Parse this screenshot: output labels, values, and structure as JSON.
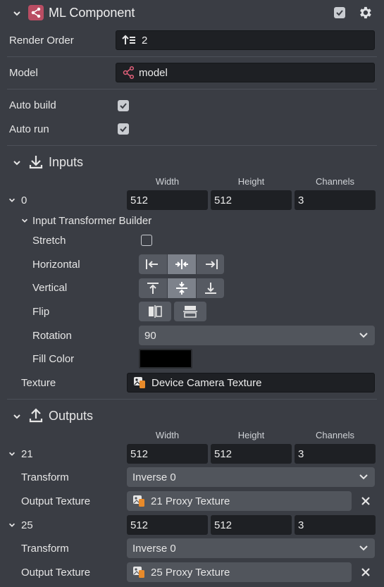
{
  "header": {
    "title": "ML Component",
    "enabled": true
  },
  "render_order": {
    "label": "Render Order",
    "value": "2"
  },
  "model": {
    "label": "Model",
    "value": "model"
  },
  "auto_build": {
    "label": "Auto build",
    "checked": true
  },
  "auto_run": {
    "label": "Auto run",
    "checked": true
  },
  "inputs": {
    "title": "Inputs",
    "col_width": "Width",
    "col_height": "Height",
    "col_channels": "Channels",
    "items": [
      {
        "name": "0",
        "width": "512",
        "height": "512",
        "channels": "3",
        "builder": {
          "title": "Input Transformer Builder",
          "stretch_label": "Stretch",
          "stretch_checked": false,
          "horizontal_label": "Horizontal",
          "horizontal_selected": "center",
          "vertical_label": "Vertical",
          "vertical_selected": "center",
          "flip_label": "Flip",
          "rotation_label": "Rotation",
          "rotation_value": "90",
          "fill_color_label": "Fill Color",
          "fill_color": "#000000"
        },
        "texture_label": "Texture",
        "texture_value": "Device Camera Texture"
      }
    ]
  },
  "outputs": {
    "title": "Outputs",
    "col_width": "Width",
    "col_height": "Height",
    "col_channels": "Channels",
    "items": [
      {
        "name": "21",
        "width": "512",
        "height": "512",
        "channels": "3",
        "transform_label": "Transform",
        "transform_value": "Inverse 0",
        "texture_label": "Output Texture",
        "texture_value": "21 Proxy Texture"
      },
      {
        "name": "25",
        "width": "512",
        "height": "512",
        "channels": "3",
        "transform_label": "Transform",
        "transform_value": "Inverse 0",
        "texture_label": "Output Texture",
        "texture_value": "25 Proxy Texture"
      }
    ]
  },
  "colors": {
    "panel_bg": "#3a3d44",
    "field_bg": "#1e2024",
    "accent_icon": "#e0607a",
    "texture_icon": "#e88a2a"
  }
}
